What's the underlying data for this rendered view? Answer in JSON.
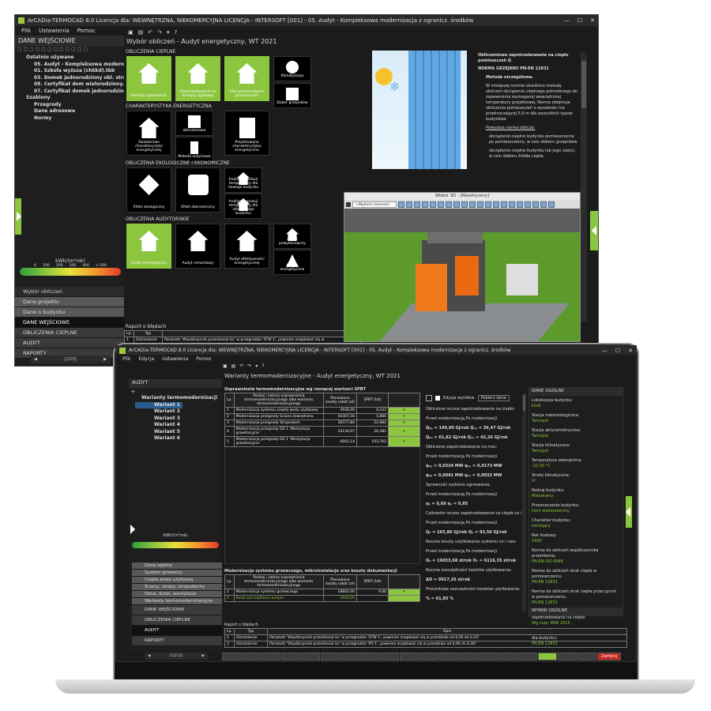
{
  "desktop": {
    "title": "ArCADia-TERMOCAD 8.0 Licencja dla: WEWNĘTRZNA, NIEKOMERCYJNA LICENCJA - INTERSOFT [001] - 05. Audyt - Kompleksowa modernizacja z ogranicz. środków",
    "menu": [
      "Plik",
      "Ustawienia",
      "Pomoc"
    ],
    "panel_header": "DANE WEJŚCIOWE",
    "tree": [
      {
        "t": "Ostatnio używane",
        "b": true,
        "i": 1
      },
      {
        "t": "05. Audyt - Kompleksowa modernizacja",
        "b": true,
        "i": 2
      },
      {
        "t": "01. Szkoła wyższa (chkkd).tbb",
        "b": true,
        "i": 2
      },
      {
        "t": "03. Domek jednorodzinny obl. strefa.tbt",
        "b": true,
        "i": 2
      },
      {
        "t": "08. Certyfikat dom wielorodzinny.tbb",
        "b": true,
        "i": 2
      },
      {
        "t": "07. Certyfikat domek jednorodzinny.tbb",
        "b": true,
        "i": 2
      },
      {
        "t": "Szablony",
        "b": true,
        "i": 1
      },
      {
        "t": "Przegrody",
        "b": true,
        "i": 2
      },
      {
        "t": "Dane adresowe",
        "b": true,
        "i": 2
      },
      {
        "t": "Normy",
        "b": true,
        "i": 2
      }
    ],
    "scale_label": "kWh/(m²rok)",
    "scale_ticks": [
      "0",
      "100",
      "200",
      "300",
      "400",
      "> 500"
    ],
    "nav": [
      "Wybór obliczeń",
      "Dane projektu",
      "Dane o budynku",
      "DANE WEJŚCIOWE",
      "OBLICZENIA CIEPLNE",
      "AUDYT",
      "RAPORTY"
    ],
    "pager": "[1/13]",
    "main_title": "Wybór obliczeń - Audyt energetyczny, WT 2021",
    "sections": [
      "OBLICZENIA CIEPLNE",
      "CHARAKTERYSTYKA ENERGETYCZNA",
      "OBLICZENIA EKOLOGICZNE I EKONOMICZNE",
      "OBLICZENIA AUDYTORSKIE"
    ],
    "tiles_heat": [
      "Bariadu ogrzewania",
      "Zapotrzebowanie na energię użytkową",
      "Obciążenie cieplne pomieszczeń"
    ],
    "tiles_small_heat": [
      "Klimatyzacja",
      "Dobór grzejników"
    ],
    "tiles_char": [
      "Świadectwo charakterystyki energetycznej",
      "Metoda obliczeniowa",
      "Metoda zużyciowa",
      "Projektowana charakterystyka energetyczna"
    ],
    "tiles_eco": [
      "Efekt ekologiczny",
      "Efekt ekonomiczny",
      "Analiza regulacji temperatury dla nowego budynku",
      "Analiza regulacji temperatury dla istniejącego budynku"
    ],
    "tiles_audit": [
      "Audyt energetyczny",
      "Audyt remontowy",
      "Audyt efektywności energetycznej",
      "Audyt powykonawczy",
      "Ocena energetyczna"
    ],
    "report_header": "Raport o błędach",
    "report_cols": [
      "Lp.",
      "Typ"
    ],
    "report_row": [
      "1",
      "Ostrzeżenie",
      "Parametr 'Współczynnik przenikania Uc' w przegrodzie 'STW 1', powinien znajdować się w"
    ],
    "right_text": {
      "title": "Obliczeniowe zapotrzebowanie na ciepło pomieszczeń Q",
      "norm": "NORMA GRZEJNIKI PN-EN 12831",
      "method": "Metoda szczegółowa.",
      "body": "W niniejszej normie określono metodę obliczeń obciążenia cieplnego potrzebnego do zapewnienia wymaganej wewnętrznej temperatury projektowej. Norma obejmuje obliczenia pomieszczeń o wysokości nie przekraczającej 5,0 m dla wszystkich typów budynków.",
      "link": "Powyższa norma oblicza:",
      "b1": "obciążenie cieplne budynku pomieszczenie po pomieszczeniu, w celu doboru grzejników",
      "b2": "obciążenie cieplne budynku lub jego części, w celu doboru źródła ciepła."
    },
    "view3d": {
      "title": "Widok 3D - [Nieaktywny]",
      "camera": "<Wybierz kamerę>"
    }
  },
  "laptop": {
    "title": "ArCADia-TERMOCAD 8.0 Licencja dla: WEWNĘTRZNA, NIEKOMERCYJNA LICENCJA - INTERSOFT [001] - 05. Audyt - Kompleksowa modernizacja z ogranicz. środków",
    "menu": [
      "Plik",
      "Edycja",
      "Ustawienia",
      "Pomoc"
    ],
    "main_title": "Warianty termomodernizacyjne - Audyt energetyczny, WT 2021",
    "panel_header": "AUDYT",
    "tree": [
      "Warianty termomodernizacji",
      "Wariant 1",
      "Wariant 2",
      "Wariant 3",
      "Wariant 4",
      "Wariant 5",
      "Wariant 6"
    ],
    "scale_label": "kWh/(m²rok)",
    "nav": [
      "Dane ogólne",
      "System grzewczy",
      "Ciepła woda użytkowa",
      "Ściany, stropy, stropodachy",
      "Okna, drzwi, wentylacja",
      "Warianty termomodernizacyjne",
      "DANE WEJŚCIOWE",
      "OBLICZENIA CIEPLNE",
      "AUDYT",
      "RAPORTY"
    ],
    "pager": "[12/13]",
    "t1_title": "Usprawnienia termomodernizacyjne wg rosnącej wartości SPBT",
    "t1_cols": [
      "Lp.",
      "Rodzaj i zakres usprawnienia termomodernizacyjnego albo wariantu termomodernizacyjnego",
      "Planowane koszty robót [zł]",
      "SPBT [lat]",
      ""
    ],
    "t1_rows": [
      [
        "1",
        "Modernizacja systemu ciepłej wody użytkowej",
        "3936,00",
        "4,143"
      ],
      [
        "2",
        "Modernizacja przegrody Ściana zewnętrzna",
        "44307,56",
        "5,886"
      ],
      [
        "3",
        "Modernizacja przegrody Stropodach",
        "36577,84",
        "22,682"
      ],
      [
        "4",
        "Modernizacja przegrody DZ 1 'Wentylacja grawitacyjna'",
        "33134,97",
        "26,381"
      ],
      [
        "5",
        "Modernizacja przegrody DZ 1 'Wentylacja grawitacyjna'",
        "4942,14",
        "103,762"
      ]
    ],
    "t2_title": "Modernizacja systemu grzewczego, mikroinstalacja oraz koszty dokumentacji",
    "t2_cols": [
      "Lp.",
      "Rodzaj i zakres usprawnienia termomodernizacyjnego albo wariantu termomodernizacyjnego",
      "Planowane koszty robót [zł]",
      "SPBT [lat]",
      ""
    ],
    "t2_rows": [
      [
        "1",
        "Modernizacja systemu grzewczego",
        "18842,00",
        "9,66"
      ],
      [
        "2",
        "Koszt sporządzenia audytu",
        "1840,00",
        ""
      ]
    ],
    "mid": {
      "edit_label": "Edycja wyników",
      "fetch_button": "Pobierz dane",
      "lines": [
        "Obliczone roczne zapotrzebowanie na ciepło:",
        "Przed modernizacją          Po modernizacji",
        "Q₀ₚ = 140,90 GJ/rok       Q₁ₚ = 36,47 GJ/rok",
        "Q₀ₐ = 61,82 GJ/rok        Q₁ₐ = 42,26 GJ/rok",
        "Obliczone zapotrzebowanie na moc:",
        "Przed modernizacją          Po modernizacji",
        "q₀ₚ = 0,0324 MW          q₁ₚ = 0,0173 MW",
        "q₀ₐ = 0,0041 MW          q₁ₐ = 0,0033 MW",
        "Sprawność systemu ogrzewania:",
        "Przed modernizacją          Po modernizacji",
        "η₀ = 0,69                        η₁ = 0,85",
        "Całkowite roczne zapotrzebowanie na ciepło co i cwu:",
        "Przed modernizacją          Po modernizacji",
        "Q₀ = 265,86 GJ/rok        Q₁ = 93,56 GJ/rok",
        "Roczne koszty użytkowania systemu co i cwu:",
        "Przed modernizacją          Po modernizacji",
        "O₀ = 16033,68 zł/rok     O₁ = 6116,35 zł/rok",
        "Roczne oszczędności kosztów użytkowania:",
        "ΔO = 9917,26 zł/rok",
        "Procentowe oszczędności kosztów użytkowania:",
        "% = 61,85 %"
      ]
    },
    "props_header": "DANE OGÓLNE",
    "props": [
      {
        "k": "Lokalizacja budynku:",
        "v": "Łódź"
      },
      {
        "k": "Stacja meteorologiczna:",
        "v": "Tarnopol"
      },
      {
        "k": "Stacja aktynometryczna:",
        "v": "Tarnopol"
      },
      {
        "k": "Stacja klimatyczna:",
        "v": "Tarnopol"
      },
      {
        "k": "Temperatura zewnętrzna:",
        "v": "-22,00 °C"
      },
      {
        "k": "Strefa klimatyczna:",
        "v": "IV"
      },
      {
        "k": "Rodzaj budynku:",
        "v": "Mieszkalny"
      },
      {
        "k": "Przeznaczenie budynku:",
        "v": "Dom wielorodzinny"
      },
      {
        "k": "Charakter budynku:",
        "v": "Istniejący"
      },
      {
        "k": "Rok budowy:",
        "v": "1990"
      },
      {
        "k": "Norma do obliczeń współczynnika przenikania:",
        "v": "PN-EN ISO 6946"
      },
      {
        "k": "Norma do obliczeń strat ciepła w pomieszczeniu:",
        "v": "PN-EN 12831"
      },
      {
        "k": "Norma do obliczeń strat ciepła przez grunt w pomieszczeniu:",
        "v": "PN-EN 12831"
      },
      {
        "k": "Norma do obliczeń sezonowego zapotrzebowania na ciepło:",
        "v": "Wg rozp. MiIR 2015"
      },
      {
        "k": "Norma do obliczeń strat ciepła przez grunt dla budynku:",
        "v": "PN-EN 12831"
      }
    ],
    "props_footer": "WYNIKI OGÓLNE",
    "report_header": "Raport o błędach",
    "report_cols": [
      "Lp.",
      "Typ",
      "Opis"
    ],
    "report_rows": [
      [
        "1",
        "Ostrzeżenie",
        "Parametr 'Współczynnik przenikania Uc' w przegrodzie 'STW 1', powinien znajdować się w przedziale od 0,00 do 0,25!"
      ],
      [
        "2",
        "Ostrzeżenie",
        "Parametr 'Współczynnik przenikania Uc' w przegrodzie 'PG 1', powinien znajdować się w przedziale od 0,00 do 0,30!"
      ]
    ],
    "close_button": "Zamknij"
  }
}
